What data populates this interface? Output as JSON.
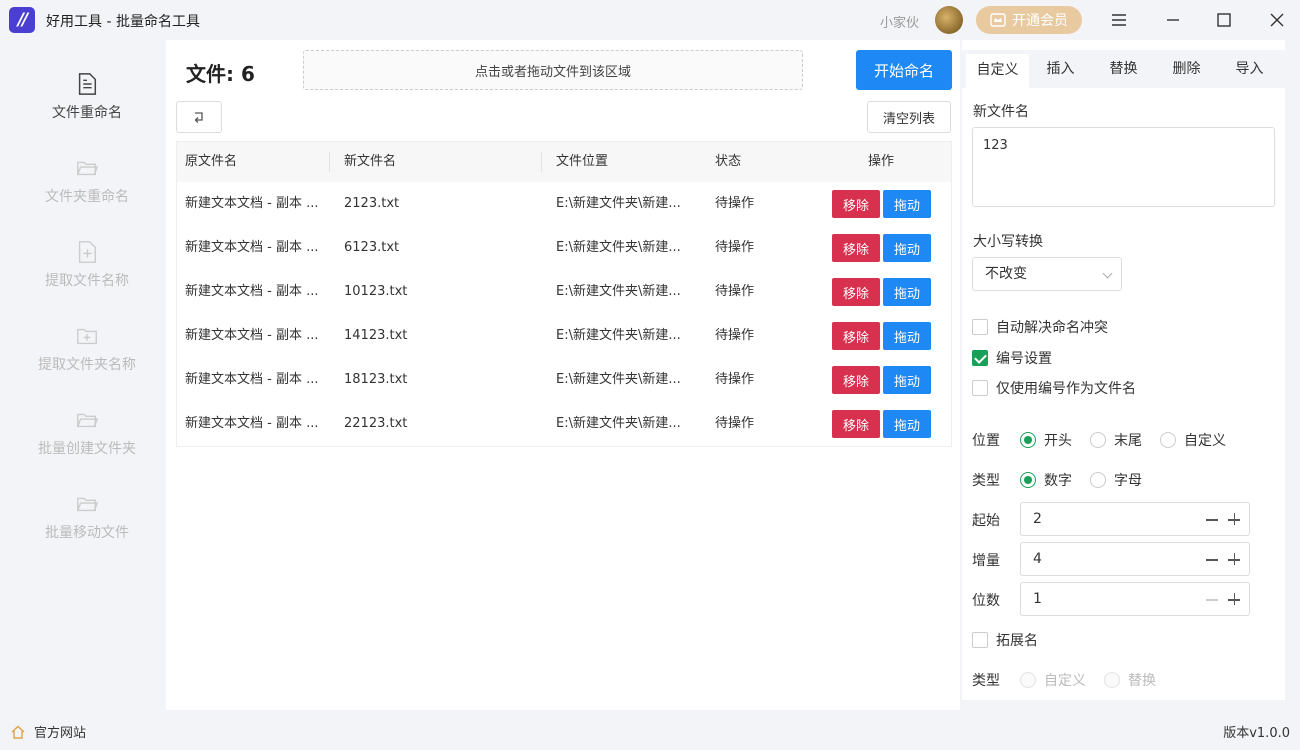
{
  "app": {
    "title": "好用工具 - 批量命名工具",
    "logo": "//"
  },
  "header": {
    "user_name": "小家伙",
    "vip_label": "开通会员"
  },
  "sidebar": {
    "items": [
      {
        "label": "文件重命名",
        "icon": "file-text-icon",
        "active": true
      },
      {
        "label": "文件夹重命名",
        "icon": "folder-open-icon",
        "active": false
      },
      {
        "label": "提取文件名称",
        "icon": "file-plus-icon",
        "active": false
      },
      {
        "label": "提取文件夹名称",
        "icon": "folder-plus-icon",
        "active": false
      },
      {
        "label": "批量创建文件夹",
        "icon": "folder-open-icon",
        "active": false
      },
      {
        "label": "批量移动文件",
        "icon": "folder-open-icon",
        "active": false
      }
    ]
  },
  "main": {
    "file_count": "文件: 6",
    "dropzone": "点击或者拖动文件到该区域",
    "start_label": "开始命名",
    "undo_icon": "undo-icon",
    "clear_label": "清空列表",
    "columns": [
      "原文件名",
      "新文件名",
      "文件位置",
      "状态",
      "操作"
    ],
    "rows": [
      {
        "original": "新建文本文档 - 副本 ...",
        "new": "2123.txt",
        "location": "E:\\新建文件夹\\新建...",
        "status": "待操作"
      },
      {
        "original": "新建文本文档 - 副本 ...",
        "new": "6123.txt",
        "location": "E:\\新建文件夹\\新建...",
        "status": "待操作"
      },
      {
        "original": "新建文本文档 - 副本 ...",
        "new": "10123.txt",
        "location": "E:\\新建文件夹\\新建...",
        "status": "待操作"
      },
      {
        "original": "新建文本文档 - 副本 ...",
        "new": "14123.txt",
        "location": "E:\\新建文件夹\\新建...",
        "status": "待操作"
      },
      {
        "original": "新建文本文档 - 副本 ...",
        "new": "18123.txt",
        "location": "E:\\新建文件夹\\新建...",
        "status": "待操作"
      },
      {
        "original": "新建文本文档 - 副本 ...",
        "new": "22123.txt",
        "location": "E:\\新建文件夹\\新建...",
        "status": "待操作"
      }
    ],
    "remove_label": "移除",
    "drag_label": "拖动"
  },
  "panel": {
    "tabs": [
      "自定义",
      "插入",
      "替换",
      "删除",
      "导入"
    ],
    "new_name_label": "新文件名",
    "new_name_value": "123",
    "case_label": "大小写转换",
    "case_value": "不改变",
    "checks": {
      "auto_resolve": {
        "label": "自动解决命名冲突",
        "checked": false
      },
      "numbering": {
        "label": "编号设置",
        "checked": true
      },
      "number_only": {
        "label": "仅使用编号作为文件名",
        "checked": false
      },
      "extension": {
        "label": "拓展名",
        "checked": false
      }
    },
    "position_label": "位置",
    "position_options": [
      "开头",
      "末尾",
      "自定义"
    ],
    "type_label": "类型",
    "type_options": [
      "数字",
      "字母"
    ],
    "start_label": "起始",
    "start_value": "2",
    "increment_label": "增量",
    "increment_value": "4",
    "digits_label": "位数",
    "digits_value": "1",
    "ext_type_label": "类型",
    "ext_type_options": [
      "自定义",
      "替换"
    ]
  },
  "footer": {
    "website_label": "官方网站",
    "version": "版本v1.0.0"
  },
  "colors": {
    "primary": "#1e88f5",
    "danger": "#d8304f",
    "success": "#18a058",
    "vip": "#e8c9a0",
    "logo": "#4a3fd1"
  }
}
